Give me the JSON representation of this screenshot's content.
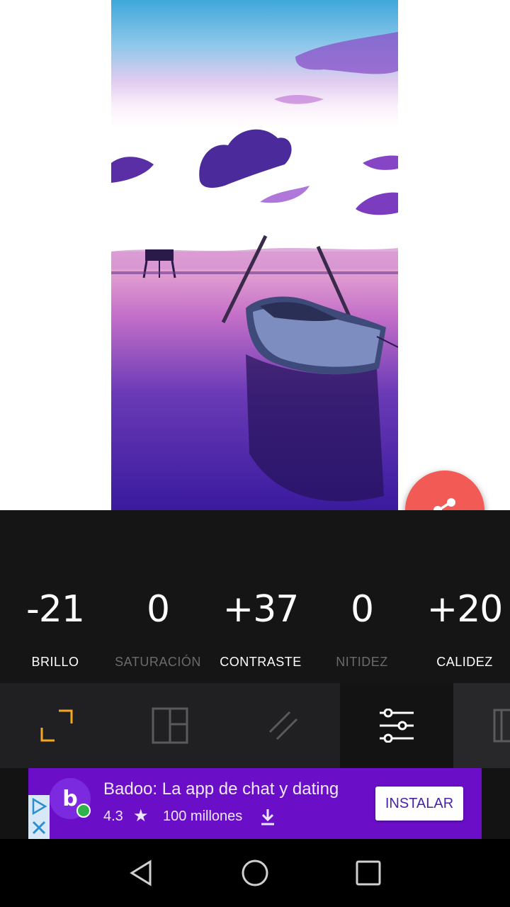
{
  "adjustments": [
    {
      "value": "-21",
      "label": "BRILLO",
      "active": true
    },
    {
      "value": "0",
      "label": "SATURACIÓN",
      "active": false
    },
    {
      "value": "+37",
      "label": "CONTRASTE",
      "active": true
    },
    {
      "value": "0",
      "label": "NITIDEZ",
      "active": false
    },
    {
      "value": "+20",
      "label": "CALIDEZ",
      "active": true
    }
  ],
  "toolbar": {
    "tools": [
      "crop-icon",
      "layout-icon",
      "stripes-icon",
      "sliders-icon",
      "split-icon"
    ],
    "active_tool": "sliders-icon"
  },
  "ad": {
    "title": "Badoo: La app de chat y dating",
    "rating": "4.3",
    "installs": "100 millones",
    "install_label": "INSTALAR",
    "logo_letter": "b"
  },
  "colors": {
    "fab": "#f25b55",
    "accent_crop": "#f5a623",
    "ad_background": "#6a0fc7",
    "panel": "#151515"
  },
  "nav": [
    "back-icon",
    "home-icon",
    "recents-icon"
  ]
}
